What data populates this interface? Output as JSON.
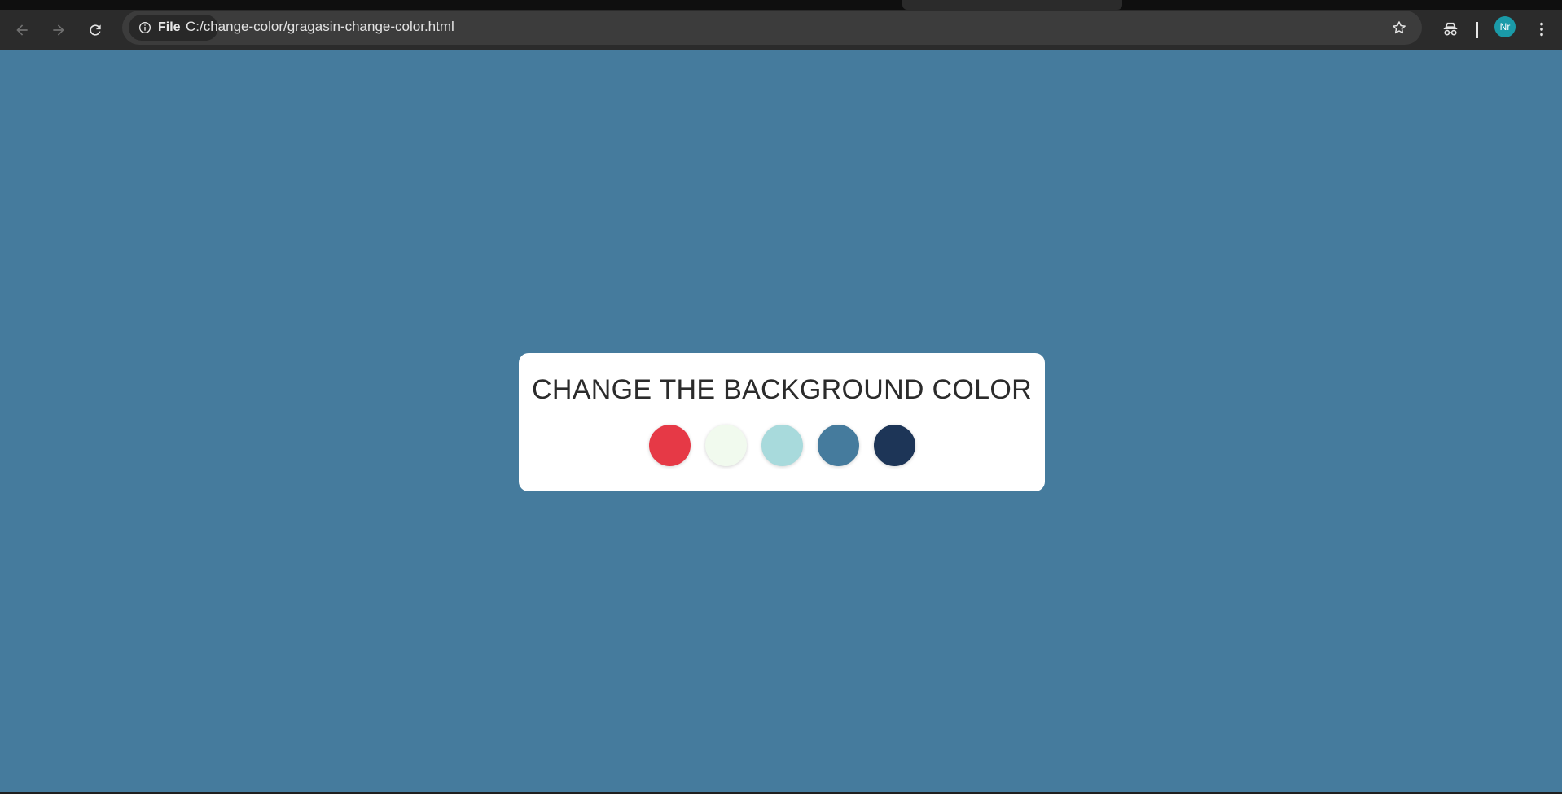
{
  "browser": {
    "site_chip_label": "File",
    "url": "C:/change-color/gragasin-change-color.html",
    "profile_initials": "Nr",
    "icons": {
      "back": "back-arrow-icon",
      "forward": "forward-arrow-icon",
      "reload": "reload-icon",
      "info": "info-icon",
      "bookmark": "star-icon",
      "incognito": "incognito-icon",
      "menu": "kebab-menu-icon"
    }
  },
  "page": {
    "background_color": "#457b9d",
    "title": "CHANGE THE BACKGROUND COLOR",
    "swatches": [
      {
        "color": "#e63946"
      },
      {
        "color": "#f1faee"
      },
      {
        "color": "#a8dadc"
      },
      {
        "color": "#457b9d"
      },
      {
        "color": "#1d3557"
      }
    ]
  }
}
